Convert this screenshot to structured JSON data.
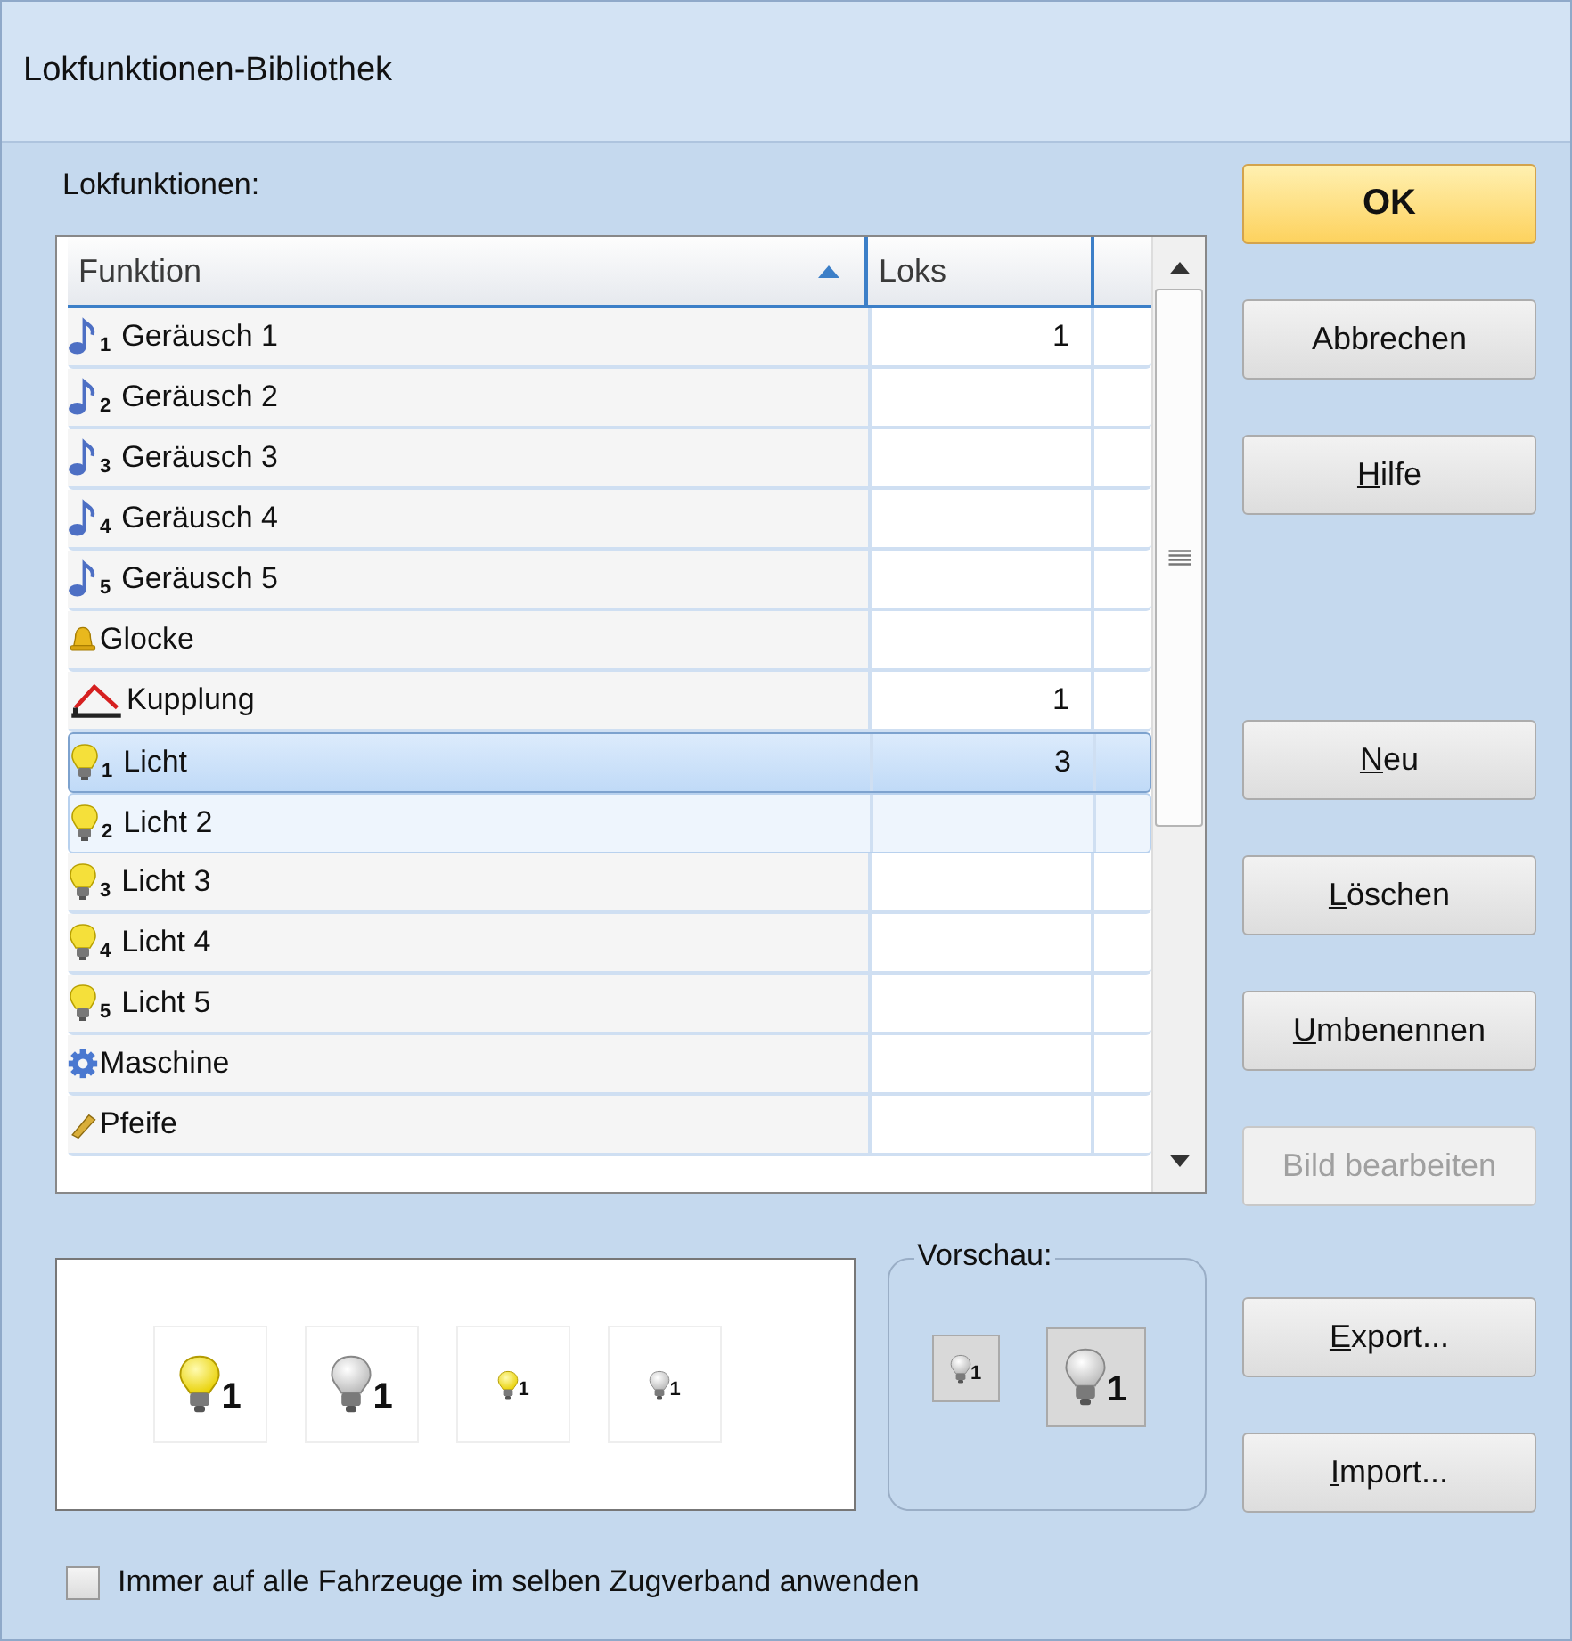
{
  "window": {
    "title": "Lokfunktionen-Bibliothek"
  },
  "list_label": "Lokfunktionen:",
  "table": {
    "columns": [
      {
        "label": "Funktion",
        "sorted": true
      },
      {
        "label": "Loks",
        "sorted": false
      }
    ],
    "rows": [
      {
        "kind": "note",
        "badge": "1",
        "name": "Geräusch 1",
        "loks": "1",
        "selected": false,
        "hovered": false
      },
      {
        "kind": "note",
        "badge": "2",
        "name": "Geräusch 2",
        "selected": false,
        "hovered": false
      },
      {
        "kind": "note",
        "badge": "3",
        "name": "Geräusch 3",
        "selected": false,
        "hovered": false
      },
      {
        "kind": "note",
        "badge": "4",
        "name": "Geräusch 4",
        "selected": false,
        "hovered": false
      },
      {
        "kind": "note",
        "badge": "5",
        "name": "Geräusch 5",
        "selected": false,
        "hovered": false
      },
      {
        "kind": "bell",
        "name": "Glocke",
        "selected": false,
        "hovered": false
      },
      {
        "kind": "coupling",
        "name": "Kupplung",
        "loks": "1",
        "selected": false,
        "hovered": false
      },
      {
        "kind": "bulb",
        "badge": "1",
        "name": "Licht",
        "loks": "3",
        "selected": true,
        "hovered": false
      },
      {
        "kind": "bulb",
        "badge": "2",
        "name": "Licht 2",
        "selected": false,
        "hovered": true
      },
      {
        "kind": "bulb",
        "badge": "3",
        "name": "Licht 3",
        "selected": false,
        "hovered": false
      },
      {
        "kind": "bulb",
        "badge": "4",
        "name": "Licht 4",
        "selected": false,
        "hovered": false
      },
      {
        "kind": "bulb",
        "badge": "5",
        "name": "Licht 5",
        "selected": false,
        "hovered": false
      },
      {
        "kind": "gear",
        "name": "Maschine",
        "selected": false,
        "hovered": false
      },
      {
        "kind": "whistle",
        "name": "Pfeife",
        "selected": false,
        "hovered": false
      }
    ]
  },
  "images": [
    {
      "lit": true,
      "large": true,
      "badge": "1"
    },
    {
      "lit": false,
      "large": true,
      "badge": "1"
    },
    {
      "lit": true,
      "large": false,
      "badge": "1"
    },
    {
      "lit": false,
      "large": false,
      "badge": "1"
    }
  ],
  "preview": {
    "label": "Vorschau:",
    "images": [
      {
        "lit": false,
        "large": false,
        "badge": "1"
      },
      {
        "lit": false,
        "large": true,
        "badge": "1"
      }
    ]
  },
  "button_groups": [
    [
      {
        "label": "OK",
        "default": true,
        "underline_first": false,
        "disabled": false
      },
      {
        "label": "Abbrechen",
        "default": false,
        "underline_first": false,
        "disabled": false
      },
      {
        "label": "Hilfe",
        "default": false,
        "underline_first": true,
        "disabled": false
      }
    ],
    [
      {
        "label": "Neu",
        "default": false,
        "underline_first": true,
        "disabled": false
      },
      {
        "label": "Löschen",
        "default": false,
        "underline_first": true,
        "disabled": false
      },
      {
        "label": "Umbenennen",
        "default": false,
        "underline_first": true,
        "disabled": false
      },
      {
        "label": "Bild bearbeiten",
        "default": false,
        "underline_first": false,
        "disabled": true
      }
    ],
    [
      {
        "label": "Export...",
        "default": false,
        "underline_first": true,
        "disabled": false
      },
      {
        "label": "Import...",
        "default": false,
        "underline_first": true,
        "disabled": false
      }
    ]
  ],
  "checkbox": {
    "label": "Immer auf alle Fahrzeuge im selben Zugverband anwenden",
    "checked": false
  }
}
